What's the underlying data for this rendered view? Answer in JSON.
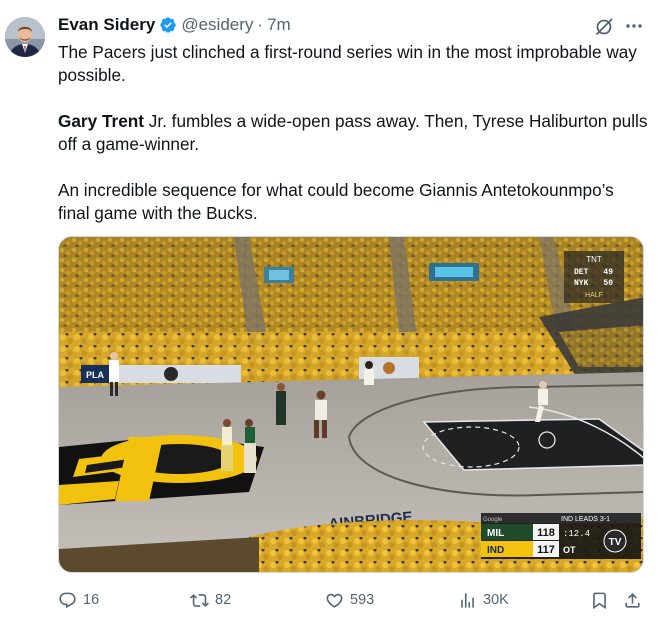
{
  "author": {
    "name": "Evan Sidery",
    "handle": "@esidery",
    "separator": "·",
    "time": "7m",
    "verified": true,
    "verified_color": "#1d9bf0"
  },
  "tweet": {
    "paragraph1": "The Pacers just clinched a first-round series win in the most improbable way possible.",
    "paragraph2_bold": "Gary Trent",
    "paragraph2_rest": " Jr. fumbles a wide-open pass away. Then, Tyrese Haliburton pulls off a game-winner.",
    "paragraph3": "An incredible sequence for what could become Giannis Antetokounmpo’s final game with the Bucks."
  },
  "media": {
    "alt_icon": "basketball-broadcast-image",
    "ticker": {
      "network": "TNT",
      "row1_team": "DET",
      "row1_score": "49",
      "row2_team": "NYK",
      "row2_score": "50",
      "period": "HALF"
    },
    "scorebug": {
      "series": "IND LEADS 3-1",
      "team1": "MIL",
      "team1_score": "118",
      "clock": ":12.4",
      "team2": "IND",
      "team2_score": "117",
      "period": "OT",
      "network": "TV",
      "sponsor": "Google"
    },
    "court_brand": "AINBRIDGE",
    "sign_text": "PLA"
  },
  "actions": {
    "replies": "16",
    "retweets": "82",
    "likes": "593",
    "views": "30K"
  },
  "colors": {
    "text": "#0f1419",
    "secondary": "#536471",
    "accent": "#1d9bf0"
  },
  "icons": [
    "grok-icon",
    "more-icon",
    "reply-icon",
    "retweet-icon",
    "like-icon",
    "views-icon",
    "bookmark-icon",
    "share-icon",
    "verified-icon"
  ]
}
